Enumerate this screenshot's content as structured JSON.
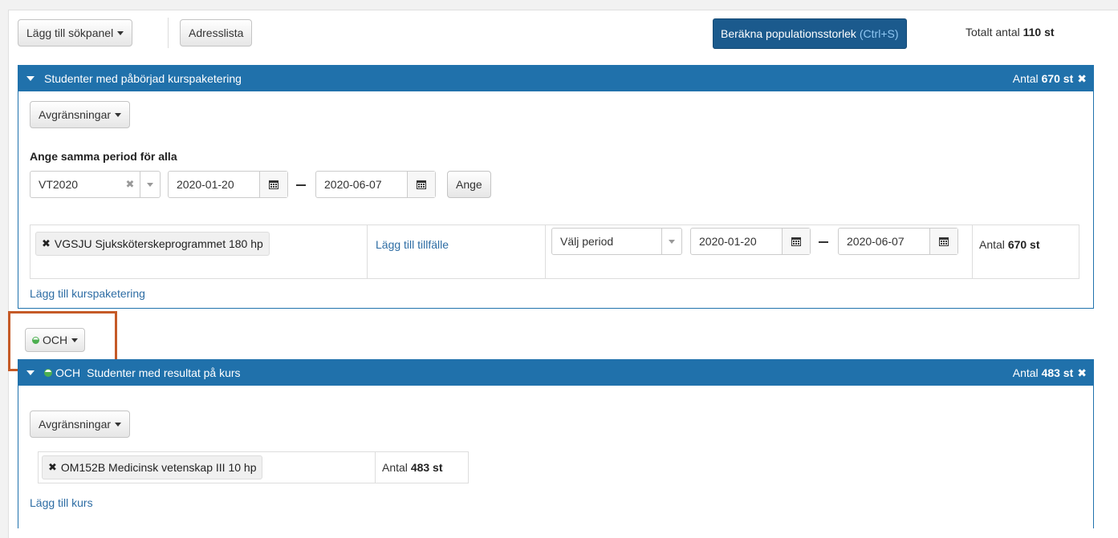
{
  "toolbar": {
    "add_panel_label": "Lägg till sökpanel",
    "address_list_label": "Adresslista",
    "calc_label": "Beräkna populationsstorlek",
    "calc_shortcut": "(Ctrl+S)",
    "total_prefix": "Totalt antal",
    "total_value": "110 st"
  },
  "panel1": {
    "title": "Studenter med påbörjad kurspaketering",
    "count_prefix": "Antal",
    "count_value": "670 st",
    "restrictions_label": "Avgränsningar",
    "same_period_heading": "Ange samma period för alla",
    "period_value": "VT2020",
    "start_date": "2020-01-20",
    "end_date": "2020-06-07",
    "apply_label": "Ange",
    "row": {
      "program_tag": "VGSJU Sjuksköterskeprogrammet 180 hp",
      "add_occasion_link": "Lägg till tillfälle",
      "period_placeholder": "Välj period",
      "start_date": "2020-01-20",
      "end_date": "2020-06-07",
      "count_prefix": "Antal",
      "count_value": "670 st"
    },
    "add_package_link": "Lägg till kurspaketering"
  },
  "operator": {
    "label": "OCH"
  },
  "panel2": {
    "operator_label": "OCH",
    "title": "Studenter med resultat på kurs",
    "count_prefix": "Antal",
    "count_value": "483 st",
    "restrictions_label": "Avgränsningar",
    "row": {
      "course_tag": "OM152B Medicinsk vetenskap III 10 hp",
      "count_prefix": "Antal",
      "count_value": "483 st"
    },
    "add_course_link": "Lägg till kurs"
  },
  "icons": [
    "caret-down-icon",
    "close-icon",
    "calendar-icon",
    "clear-icon",
    "and-operator-icon"
  ],
  "colors": {
    "header_blue": "#2071ab",
    "primary_button": "#1b5a8d",
    "link": "#2e6da4",
    "highlight": "#c55a27"
  }
}
